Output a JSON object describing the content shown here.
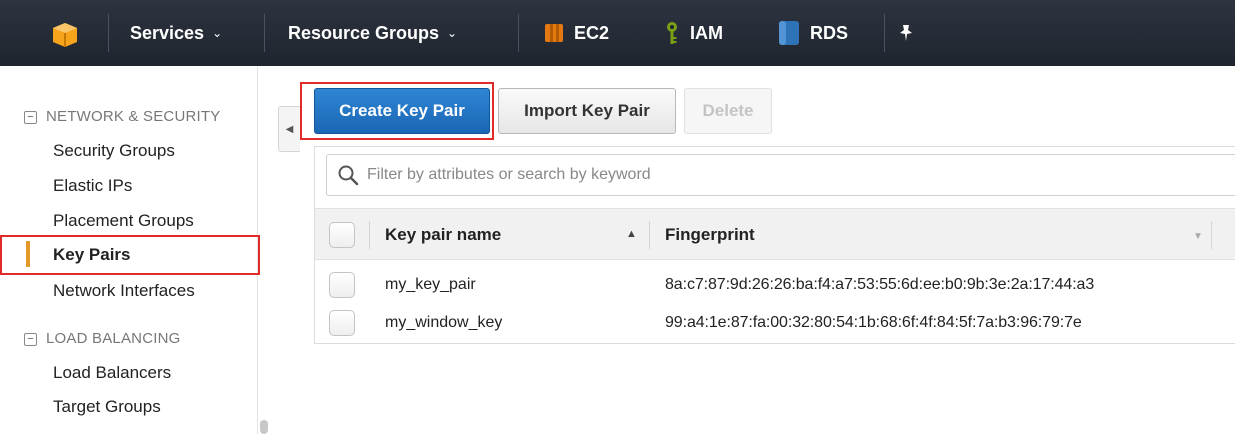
{
  "nav": {
    "logo_icon": "aws-cube-icon",
    "services_label": "Services",
    "resource_groups_label": "Resource Groups",
    "shortcuts": [
      {
        "label": "EC2",
        "icon": "ec2-icon",
        "color": "#e47911"
      },
      {
        "label": "IAM",
        "icon": "key-icon",
        "color": "#7aa116"
      },
      {
        "label": "RDS",
        "icon": "database-icon",
        "color": "#2e73b8"
      }
    ],
    "pin_icon": "pin-icon"
  },
  "sidebar": {
    "network_section": "NETWORK & SECURITY",
    "network_items": [
      "Security Groups",
      "Elastic IPs",
      "Placement Groups",
      "Key Pairs",
      "Network Interfaces"
    ],
    "active_item": "Key Pairs",
    "lb_section": "LOAD BALANCING",
    "lb_items": [
      "Load Balancers",
      "Target Groups"
    ],
    "collapse_symbol": "◀"
  },
  "toolbar": {
    "create_label": "Create Key Pair",
    "import_label": "Import Key Pair",
    "delete_label": "Delete"
  },
  "filter": {
    "placeholder": "Filter by attributes or search by keyword"
  },
  "table": {
    "columns": [
      "Key pair name",
      "Fingerprint"
    ],
    "rows": [
      {
        "name": "my_key_pair",
        "fingerprint": "8a:c7:87:9d:26:26:ba:f4:a7:53:55:6d:ee:b0:9b:3e:2a:17:44:a3"
      },
      {
        "name": "my_window_key",
        "fingerprint": "99:a4:1e:87:fa:00:32:80:54:1b:68:6f:4f:84:5f:7a:b3:96:79:7e"
      }
    ],
    "sort_asc": "▲",
    "sort_desc": "▼"
  },
  "colors": {
    "nav_bg": "#232f3e",
    "primary": "#1a66b4",
    "highlight": "#e12a2a",
    "active_bar": "#e49a2b"
  }
}
